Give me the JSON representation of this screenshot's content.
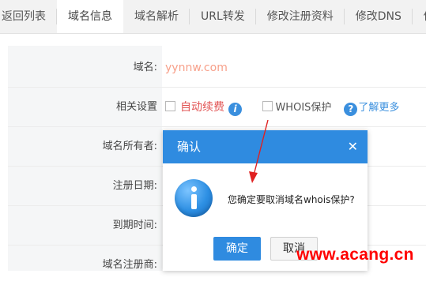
{
  "tabs": [
    "返回列表",
    "域名信息",
    "域名解析",
    "URL转发",
    "修改注册资料",
    "修改DNS",
    "修改"
  ],
  "form": {
    "domain_label": "域名:",
    "domain_value": "yynnw.com",
    "settings_label": "相关设置",
    "auto_renew": "自动续费",
    "whois": "WHOIS保护",
    "learn_more": "了解更多",
    "owner_label": "域名所有者:",
    "reg_date_label": "注册日期:",
    "expiry_label": "到期时间:",
    "registrar_label": "域名注册商:"
  },
  "dialog": {
    "title": "确认",
    "close": "✕",
    "message": "您确定要取消域名whois保护?",
    "ok": "确定",
    "cancel": "取消"
  },
  "watermark": "www.acang.cn",
  "colors": {
    "accent": "#2f8be0",
    "arrow": "#e02020",
    "watermark": "#ff0000"
  }
}
